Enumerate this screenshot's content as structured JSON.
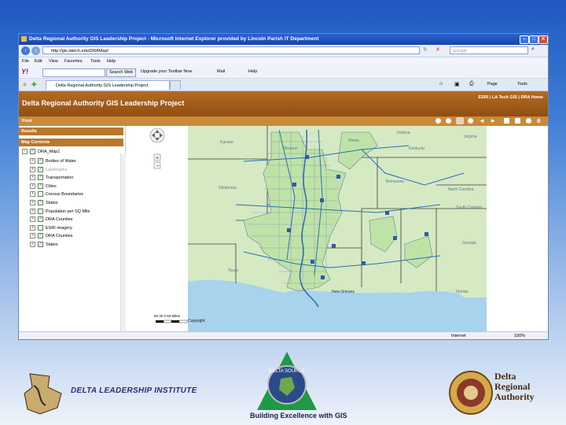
{
  "window": {
    "title": "Delta Regional Authority GIS Leadership Project - Microsoft Internet Explorer provided by Lincoln Parish IT Department",
    "url": "http://gis.latech.edu/DRAMap/",
    "search_placeholder": "Google",
    "menu": [
      "File",
      "Edit",
      "View",
      "Favorites",
      "Tools",
      "Help"
    ],
    "yahoo": {
      "search_btn": "Search Web",
      "upgrade": "Upgrade your Toolbar Now",
      "mail": "Mail",
      "help": "Help"
    },
    "tab_title": "Delta Regional Authority GIS Leadership Project",
    "cmd": {
      "page": "Page",
      "tools": "Tools"
    }
  },
  "app": {
    "title": "Delta Regional Authority GIS Leadership Project",
    "links": "ESRI  |  LA Tech GIS  |  DRA Home",
    "print": "Print",
    "results": "Results",
    "map_contents": "Map Contents",
    "map_root": "DRA_Map1",
    "layers": [
      {
        "label": "Bodies of Water",
        "checked": true
      },
      {
        "label": "Landmarks",
        "checked": true,
        "disabled": true
      },
      {
        "label": "Transportation",
        "checked": true
      },
      {
        "label": "Cities",
        "checked": true
      },
      {
        "label": "Census Boundaries",
        "checked": false
      },
      {
        "label": "States",
        "checked": true
      },
      {
        "label": "Population per SQ Mile",
        "checked": false
      },
      {
        "label": "DRA Counties",
        "checked": true
      },
      {
        "label": "ESRI imagery",
        "checked": false
      },
      {
        "label": "DRA Counties",
        "checked": true
      },
      {
        "label": "States",
        "checked": true
      }
    ],
    "map": {
      "states": [
        "Kansas",
        "Missouri",
        "Illinois",
        "Indiana",
        "Kentucky",
        "Virginia",
        "Oklahoma",
        "Tennessee",
        "North Carolina",
        "South Carolina",
        "Texas",
        "Georgia",
        "Florida"
      ],
      "scalebar": "60  30    0          60 Miles",
      "copyright": "Copyright",
      "city": "New Orleans"
    },
    "status": {
      "zone": "Internet",
      "zoom": "100%"
    }
  },
  "logos": {
    "dli": "DELTA LEADERSHIP INSTITUTE",
    "bs_ring": "DELTA SOURCE",
    "bs_tagline": "Building Excellence with GIS",
    "dra": [
      "Delta",
      "Regional",
      "Authority"
    ]
  },
  "colors": {
    "land": "#cfe5b0",
    "water": "#a9d5ec",
    "header": "#a35c1b",
    "county_line": "#5b6f9a",
    "route": "#2b6fb6"
  }
}
